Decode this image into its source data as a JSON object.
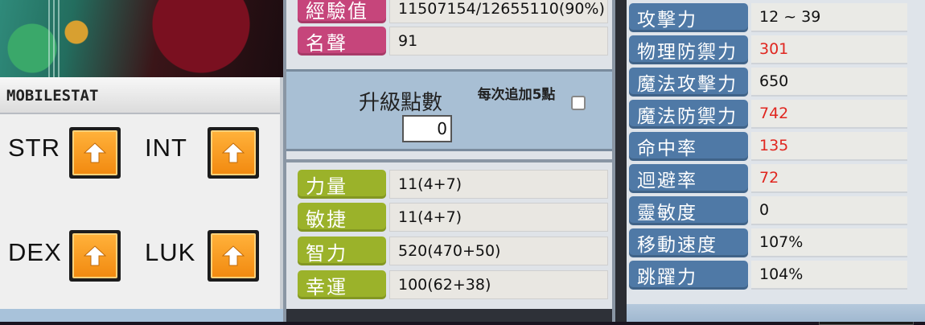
{
  "mobile_stat": {
    "title": "MOBILESTAT",
    "stats": [
      {
        "label": "STR"
      },
      {
        "label": "INT"
      },
      {
        "label": "DEX"
      },
      {
        "label": "LUK"
      }
    ]
  },
  "character": {
    "top_rows": [
      {
        "label": "經驗值",
        "value": "11507154/12655110(90%)"
      },
      {
        "label": "名聲",
        "value": "91"
      }
    ],
    "ability_points": {
      "label": "升級點數",
      "value": "0",
      "auto_label": "每次追加5點"
    },
    "stat_rows": [
      {
        "label": "力量",
        "value": "11(4+7)"
      },
      {
        "label": "敏捷",
        "value": "11(4+7)"
      },
      {
        "label": "智力",
        "value": "520(470+50)"
      },
      {
        "label": "幸運",
        "value": "100(62+38)"
      }
    ]
  },
  "detail": {
    "rows": [
      {
        "label": "攻擊力",
        "value": "12 ~ 39",
        "color": "#111111"
      },
      {
        "label": "物理防禦力",
        "value": "301",
        "color": "#e0261f"
      },
      {
        "label": "魔法攻擊力",
        "value": "650",
        "color": "#111111"
      },
      {
        "label": "魔法防禦力",
        "value": "742",
        "color": "#e0261f"
      },
      {
        "label": "命中率",
        "value": "135",
        "color": "#e0261f"
      },
      {
        "label": "迴避率",
        "value": "72",
        "color": "#e0261f"
      },
      {
        "label": "靈敏度",
        "value": "0",
        "color": "#111111"
      },
      {
        "label": "移動速度",
        "value": "107%",
        "color": "#111111"
      },
      {
        "label": "跳躍力",
        "value": "104%",
        "color": "#111111"
      }
    ]
  },
  "colors": {
    "pink_label": "#c6457b",
    "green_label": "#9bb22a",
    "blue_label": "#4f79a6",
    "up_button": "#f28a10"
  },
  "icons": {
    "up_button": "up-arrow-icon"
  }
}
